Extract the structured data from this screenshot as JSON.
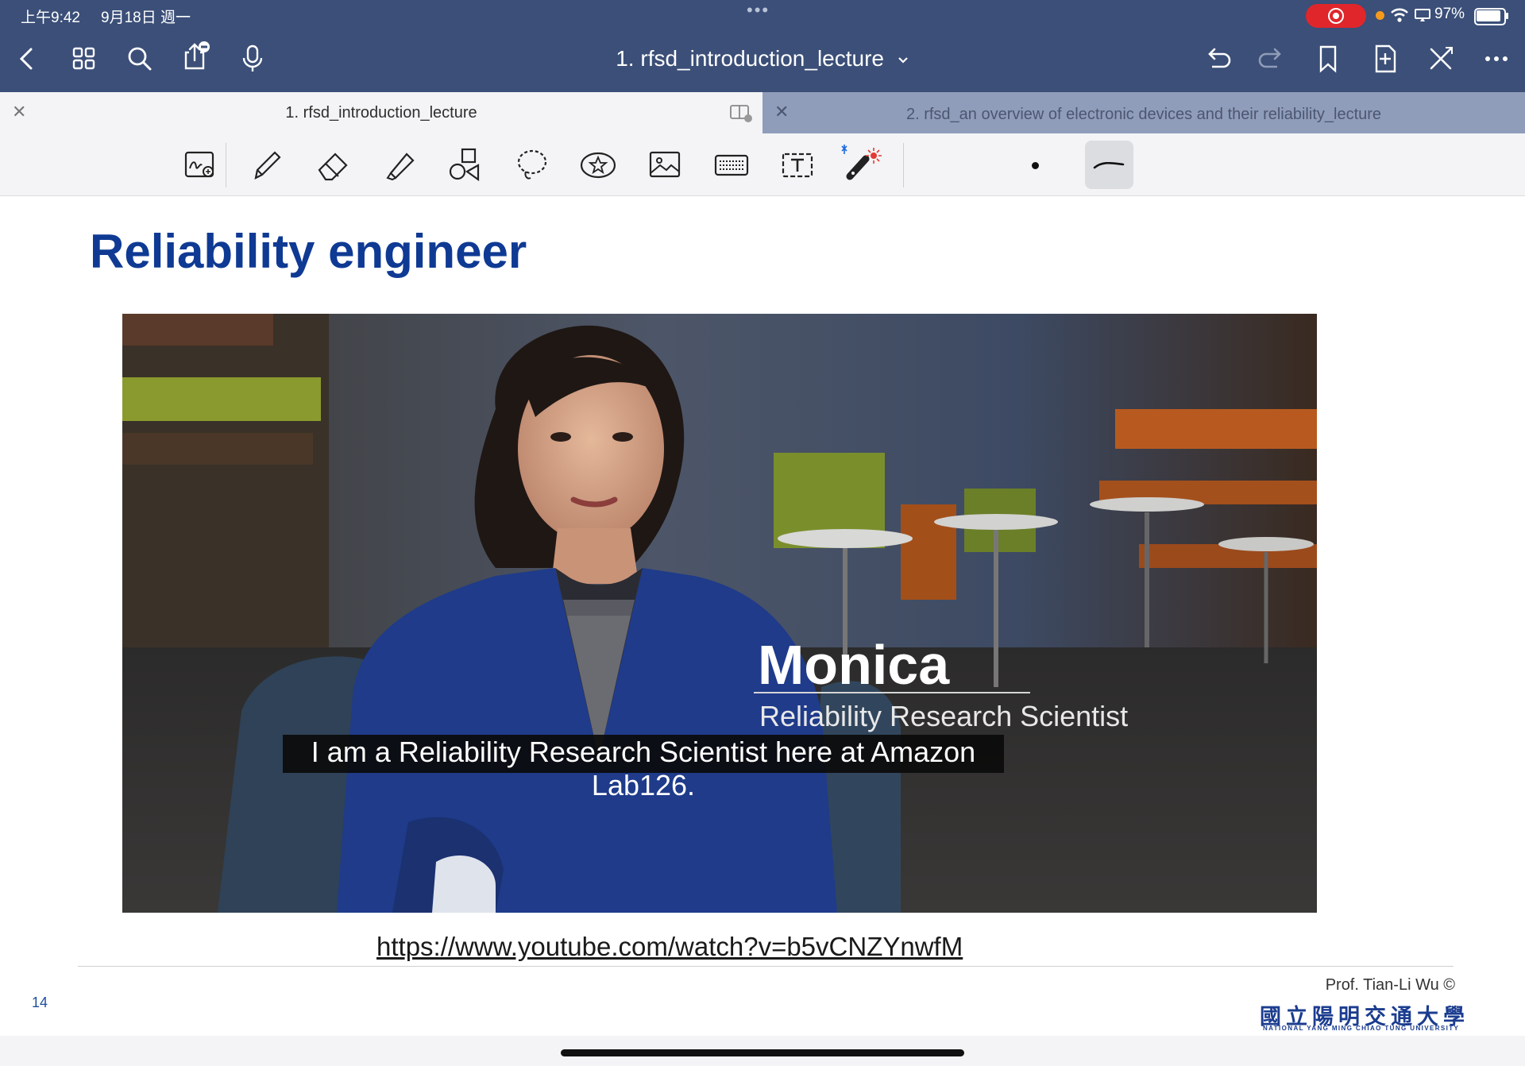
{
  "status_bar": {
    "time": "上午9:42",
    "date": "9月18日 週一",
    "dots": "•••",
    "battery": "97%"
  },
  "nav": {
    "document_title": "1. rfsd_introduction_lecture"
  },
  "tabs": [
    {
      "label": "1. rfsd_introduction_lecture",
      "active": true
    },
    {
      "label": "2. rfsd_an overview of electronic devices and their reliability_lecture",
      "active": false
    }
  ],
  "toolbar": {
    "tools": [
      "zoom-box",
      "pen",
      "eraser",
      "highlighter",
      "shapes",
      "lasso",
      "elements",
      "image",
      "keyboard",
      "text",
      "laser-pointer"
    ],
    "selected_tool": "pen-style"
  },
  "slide": {
    "title": "Reliability engineer",
    "video": {
      "name": "Monica",
      "role": "Reliability Research Scientist",
      "caption": "I am a Reliability Research Scientist here at Amazon Lab126."
    },
    "link": "https://www.youtube.com/watch?v=b5vCNZYnwfM",
    "page_number": "14",
    "author": "Prof. Tian-Li Wu ©",
    "university_zh": "國立陽明交通大學",
    "university_en": "NATIONAL YANG MING CHIAO TUNG UNIVERSITY"
  },
  "colors": {
    "nav_bar": "#3b4f78",
    "tab_inactive": "#8f9dbb",
    "slide_title": "#0f3a94",
    "record_pill": "#e0262b"
  }
}
